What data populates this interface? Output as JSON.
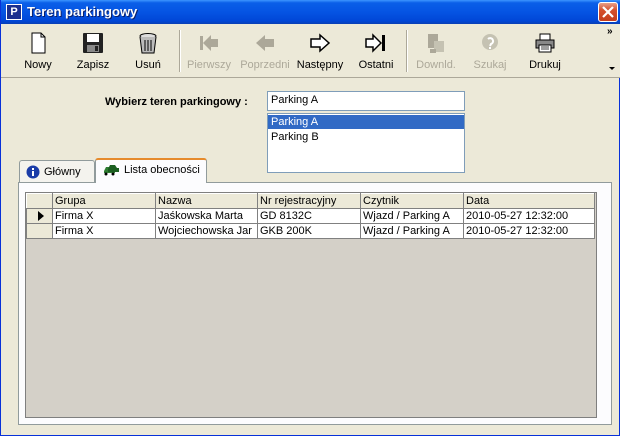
{
  "window": {
    "title": "Teren parkingowy",
    "icon_letter": "P"
  },
  "toolbar": {
    "buttons": [
      {
        "label": "Nowy",
        "icon": "new-document-icon",
        "enabled": true
      },
      {
        "label": "Zapisz",
        "icon": "save-disk-icon",
        "enabled": true
      },
      {
        "label": "Usuń",
        "icon": "trash-can-icon",
        "enabled": true
      },
      {
        "label": "Pierwszy",
        "icon": "first-record-icon",
        "enabled": false
      },
      {
        "label": "Poprzedni",
        "icon": "previous-arrow-icon",
        "enabled": false
      },
      {
        "label": "Następny",
        "icon": "next-arrow-icon",
        "enabled": true
      },
      {
        "label": "Ostatni",
        "icon": "last-record-icon",
        "enabled": true
      },
      {
        "label": "Downld.",
        "icon": "download-icon",
        "enabled": false
      },
      {
        "label": "Szukaj",
        "icon": "search-icon",
        "enabled": false
      },
      {
        "label": "Drukuj",
        "icon": "printer-icon",
        "enabled": true
      }
    ],
    "more_glyph": "»"
  },
  "selector": {
    "label": "Wybierz teren parkingowy :",
    "value": "Parking A",
    "options": [
      "Parking A",
      "Parking B"
    ],
    "selected_index": 0
  },
  "tabs": [
    {
      "label": "Główny",
      "icon": "info-icon",
      "active": false
    },
    {
      "label": "Lista obecności",
      "icon": "cars-icon",
      "active": true
    }
  ],
  "grid": {
    "columns": [
      "Grupa",
      "Nazwa",
      "Nr rejestracyjny",
      "Czytnik",
      "Data"
    ],
    "rows": [
      [
        "Firma X",
        "Jaśkowska Marta",
        "GD 8132C",
        "Wjazd / Parking A",
        "2010-05-27 12:32:00"
      ],
      [
        "Firma X",
        "Wojciechowska Jar",
        "GKB 200K",
        "Wjazd / Parking A",
        "2010-05-27 12:32:00"
      ]
    ],
    "current_row": 0
  },
  "colors": {
    "title_bar": "#0554e3",
    "selection": "#316ac5",
    "tab_highlight": "#e68b2c",
    "face": "#ece9d8"
  }
}
